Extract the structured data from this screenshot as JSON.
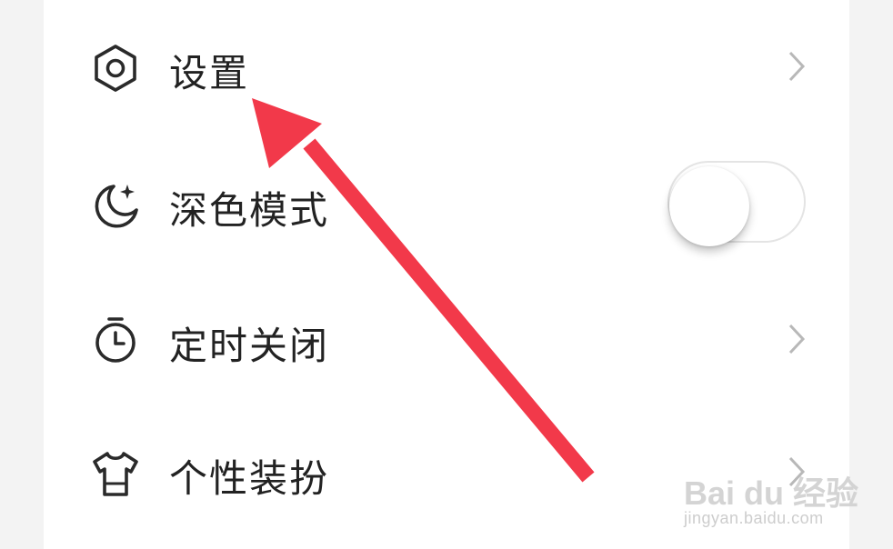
{
  "menu": {
    "items": [
      {
        "label": "设置",
        "icon": "settings-hexagon-icon",
        "control": "chevron"
      },
      {
        "label": "深色模式",
        "icon": "moon-stars-icon",
        "control": "toggle",
        "toggle_on": false
      },
      {
        "label": "定时关闭",
        "icon": "timer-icon",
        "control": "chevron"
      },
      {
        "label": "个性装扮",
        "icon": "tshirt-icon",
        "control": "chevron"
      }
    ]
  },
  "annotation": {
    "arrow_color": "#f2394a",
    "arrow_target": "设置"
  },
  "watermark": {
    "main": "Bai du 经验",
    "sub": "jingyan.baidu.com"
  },
  "colors": {
    "background": "#f3f3f3",
    "card": "#ffffff",
    "text": "#222222",
    "chevron": "#b8b8b8",
    "arrow": "#f2394a"
  }
}
